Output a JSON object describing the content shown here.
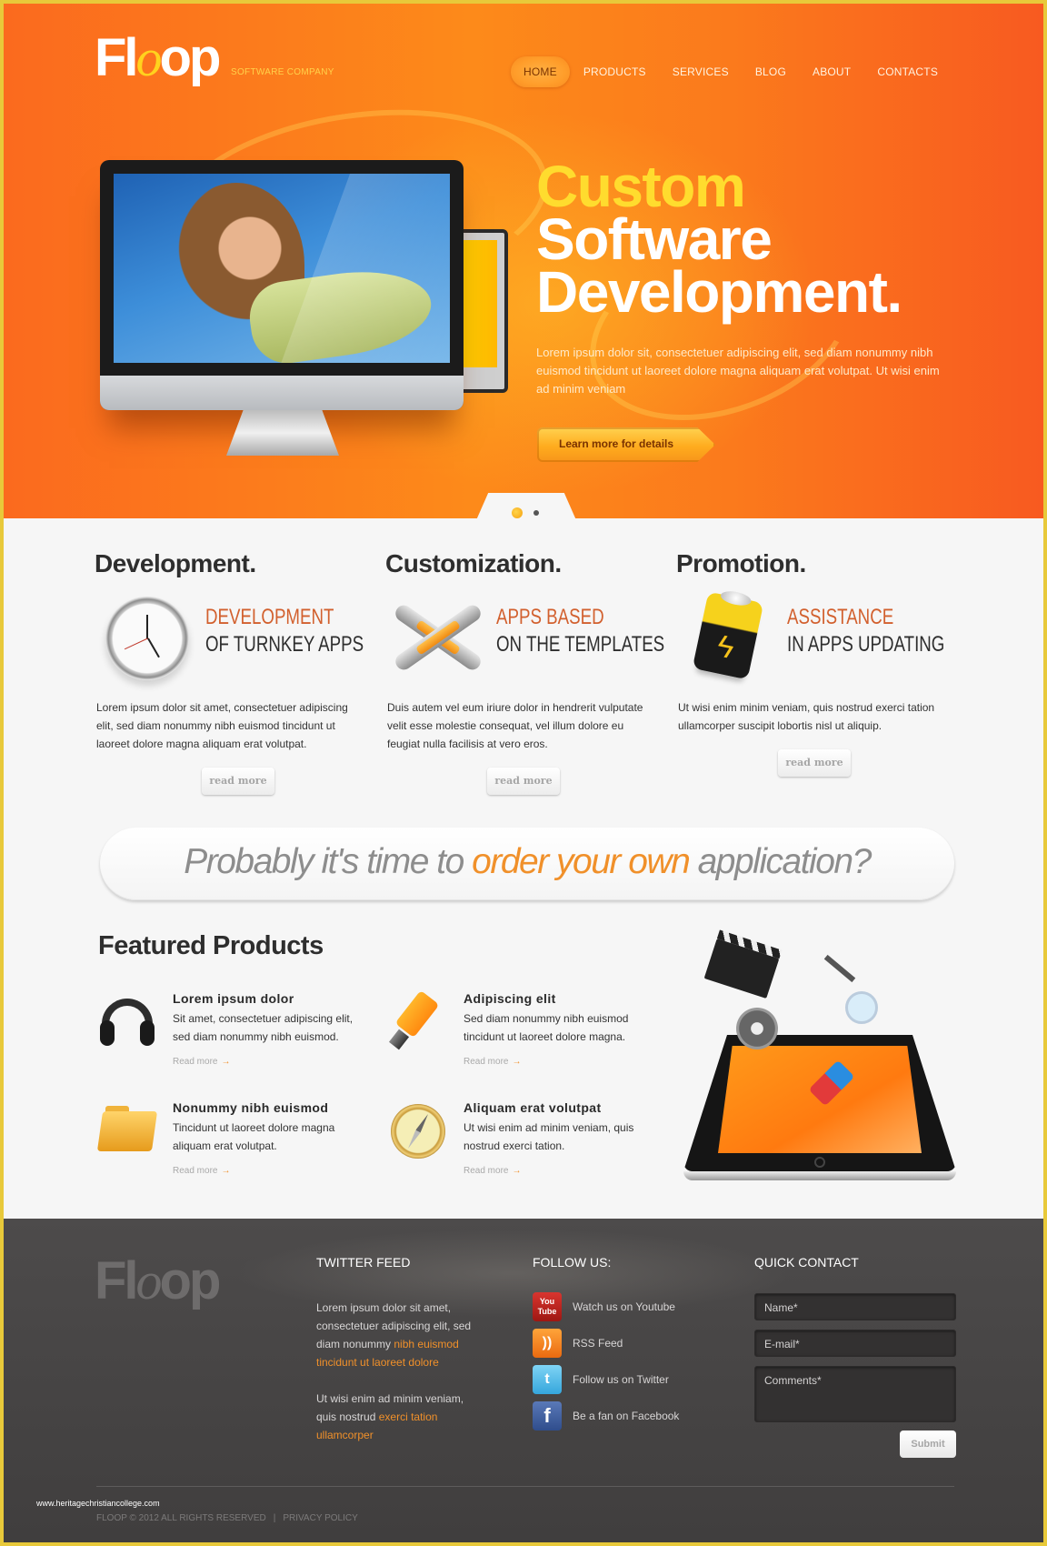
{
  "brand": {
    "logo_prefix": "Fl",
    "logo_o": "o",
    "logo_suffix": "op",
    "tagline": "SOFTWARE  COMPANY"
  },
  "nav": {
    "items": [
      {
        "label": "HOME",
        "active": true
      },
      {
        "label": "PRODUCTS",
        "active": false
      },
      {
        "label": "SERVICES",
        "active": false
      },
      {
        "label": "BLOG",
        "active": false
      },
      {
        "label": "ABOUT",
        "active": false
      },
      {
        "label": "CONTACTS",
        "active": false
      }
    ]
  },
  "hero": {
    "title_line1": "Custom",
    "title_line2": "Software",
    "title_line3": "Development.",
    "text": "Lorem ipsum dolor sit, consectetuer adipiscing elit, sed diam nonummy nibh euismod tincidunt ut laoreet dolore magna aliquam erat volutpat. Ut wisi enim ad minim veniam",
    "cta_label": "Learn more for details",
    "slides_total": 2,
    "slide_active": 1
  },
  "features": [
    {
      "title": "Development.",
      "sub_accent": "DEVELOPMENT",
      "sub_main": "OF TURNKEY APPS",
      "icon": "clock-icon",
      "text": "Lorem ipsum dolor sit amet, consectetuer adipiscing elit, sed diam nonummy nibh euismod tincidunt ut laoreet dolore magna aliquam erat volutpat.",
      "button": "read more"
    },
    {
      "title": "Customization.",
      "sub_accent": "APPS BASED",
      "sub_main": "ON THE TEMPLATES",
      "icon": "wrenches-icon",
      "text": "Duis autem vel eum iriure  dolor in hendrerit vulputate velit esse molestie consequat, vel illum dolore eu feugiat nulla facilisis at vero eros.",
      "button": "read more"
    },
    {
      "title": "Promotion.",
      "sub_accent": "ASSISTANCE",
      "sub_main": "IN APPS UPDATING",
      "icon": "battery-icon",
      "text": "Ut wisi enim minim veniam, quis nostrud exerci tation ullamcorper suscipit lobortis nisl ut aliquip.",
      "button": "read more"
    }
  ],
  "banner": {
    "before": "Probably it's time to ",
    "highlight": "order your own",
    "after": " application?"
  },
  "featured": {
    "title": "Featured Products",
    "products": [
      {
        "title": "Lorem ipsum dolor",
        "text": "Sit amet, consectetuer adipiscing elit, sed diam nonummy nibh euismod.",
        "link": "Read more",
        "icon": "headphones-icon"
      },
      {
        "title": "Adipiscing elit",
        "text": "Sed diam nonummy nibh euismod tincidunt ut laoreet dolore magna.",
        "link": "Read more",
        "icon": "highlighter-icon"
      },
      {
        "title": "Nonummy nibh euismod",
        "text": "Tincidunt ut laoreet dolore magna aliquam erat volutpat.",
        "link": "Read more",
        "icon": "folder-icon"
      },
      {
        "title": "Aliquam erat volutpat",
        "text": "Ut wisi enim ad minim veniam, quis nostrud exerci tation.",
        "link": "Read more",
        "icon": "compass-icon"
      }
    ],
    "arrow": "→"
  },
  "footer": {
    "twitter": {
      "heading": "TWITTER FEED",
      "tweet1_text": "Lorem ipsum dolor sit amet, consectetuer adipiscing elit, sed diam nonummy ",
      "tweet1_link": "nibh euismod tincidunt ut laoreet dolore",
      "tweet2_text": "Ut wisi enim ad minim veniam, quis nostrud ",
      "tweet2_link": "exerci tation ullamcorper"
    },
    "follow": {
      "heading": "FOLLOW US:",
      "items": [
        {
          "label": "Watch us on Youtube",
          "icon": "youtube-icon",
          "glyph": "You Tube"
        },
        {
          "label": "RSS Feed",
          "icon": "rss-icon",
          "glyph": "))"
        },
        {
          "label": "Follow us on Twitter",
          "icon": "twitter-icon",
          "glyph": "t"
        },
        {
          "label": "Be a fan on Facebook",
          "icon": "facebook-icon",
          "glyph": "f"
        }
      ]
    },
    "contact": {
      "heading": "QUICK CONTACT",
      "name_placeholder": "Name*",
      "email_placeholder": "E-mail*",
      "comments_placeholder": "Comments*",
      "submit": "Submit"
    },
    "copyright": "FLOOP © 2012 ALL RIGHTS RESERVED",
    "separator": "|",
    "privacy": "PRIVACY POLICY"
  },
  "watermark": "www.heritagechristiancollege.com",
  "colors": {
    "accent_orange": "#f0902a",
    "hero_orange": "#fb6a1e",
    "title_yellow": "#ffdc2e",
    "frame_yellow": "#e8c93a",
    "footer_bg": "#454343"
  }
}
